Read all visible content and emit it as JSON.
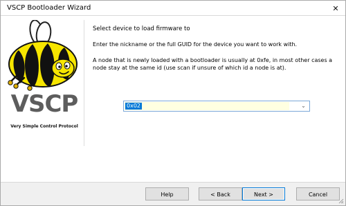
{
  "window": {
    "title": "VSCP  Bootloader Wizard",
    "close_icon": "close-icon"
  },
  "logo": {
    "title": "VSCP",
    "subtitle": "Very Simple Control Protocol",
    "mascot_icon": "bee-mascot-icon"
  },
  "content": {
    "heading": "Select device to load firmware to",
    "description": "Enter the nickname or the full GUID for the device you want to work with.",
    "note": "A node that is newly loaded with a bootloader is usually at 0xfe, in most other cases a node stay at the same id (use scan if unsure of which id a node is at)."
  },
  "device_select": {
    "value": "0x02",
    "dropdown_icon": "chevron-down-icon"
  },
  "buttons": {
    "help": "Help",
    "back": "< Back",
    "next": "Next >",
    "cancel": "Cancel"
  },
  "colors": {
    "accent": "#0078D7",
    "bee_yellow": "#F7E600",
    "bee_black": "#111111",
    "logo_gray": "#5D5D5D"
  }
}
